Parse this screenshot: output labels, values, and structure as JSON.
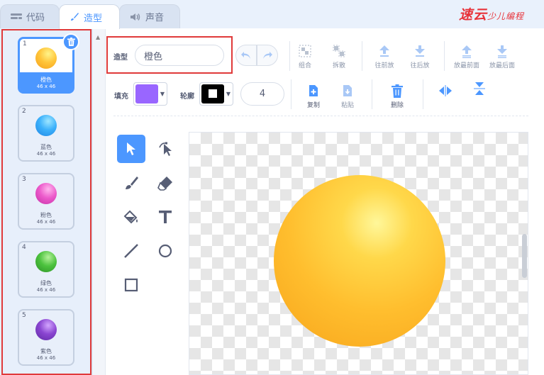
{
  "tabs": [
    {
      "label": "代码",
      "icon": "code-icon"
    },
    {
      "label": "造型",
      "icon": "brush-icon"
    },
    {
      "label": "声音",
      "icon": "speaker-icon"
    }
  ],
  "logo": {
    "main": "速云",
    "sub": "少儿编程"
  },
  "costumes": [
    {
      "index": "1",
      "name": "橙色",
      "size": "46 x 46",
      "color": "#ffb728"
    },
    {
      "index": "2",
      "name": "蓝色",
      "size": "46 x 46",
      "color": "#2fa3f6"
    },
    {
      "index": "3",
      "name": "粉色",
      "size": "46 x 46",
      "color": "#e84fc4"
    },
    {
      "index": "4",
      "name": "绿色",
      "size": "46 x 46",
      "color": "#47b83a"
    },
    {
      "index": "5",
      "name": "紫色",
      "size": "46 x 46",
      "color": "#7f3fc6"
    }
  ],
  "editor": {
    "costume_label": "造型",
    "costume_name": "橙色",
    "fill_label": "填充",
    "outline_label": "轮廓",
    "fill_color": "#9966ff",
    "outline_color": "#000000",
    "stroke_width": "4",
    "toolbar": {
      "group": "组合",
      "ungroup": "拆散",
      "forward": "往前放",
      "backward": "往后放",
      "front": "放最前面",
      "back": "放最后面",
      "copy": "复制",
      "paste": "粘贴",
      "delete": "删除"
    }
  },
  "colors": {
    "accent": "#4c97ff",
    "highlight_frame": "#e03a3a"
  }
}
